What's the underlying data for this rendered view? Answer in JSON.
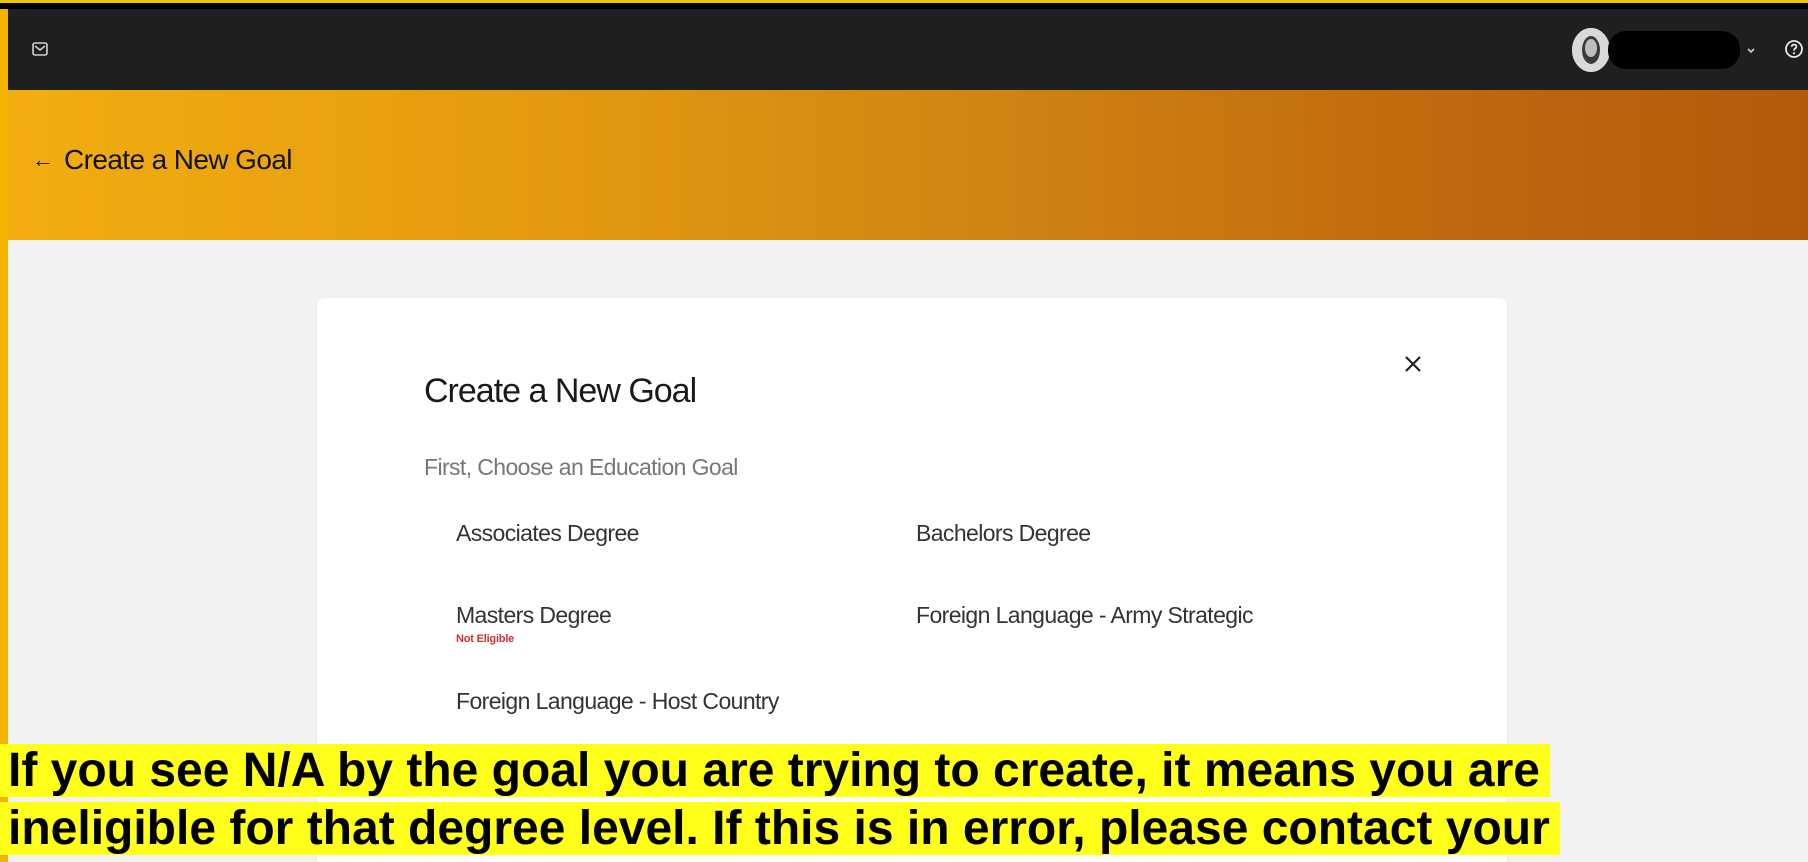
{
  "header": {
    "back_label": "Create a New Goal",
    "back_arrow": "←"
  },
  "icons": {
    "mail": "mail-icon",
    "avatar": "avatar-icon",
    "chevron": "chevron-down-icon",
    "help": "help-icon",
    "close": "close-icon",
    "back": "arrow-left-icon"
  },
  "card": {
    "title": "Create a New Goal",
    "subtitle": "First, Choose an Education Goal",
    "close_glyph": "×",
    "goals": [
      {
        "label": "Associates Degree",
        "note": ""
      },
      {
        "label": "Bachelors Degree",
        "note": ""
      },
      {
        "label": "Masters Degree",
        "note": "Not Eligible"
      },
      {
        "label": "Foreign Language - Army Strategic",
        "note": ""
      },
      {
        "label": "Foreign Language - Host Country",
        "note": ""
      }
    ]
  },
  "annotation": {
    "line1": "If you see N/A by the goal you are trying to create, it means you are",
    "line2": "ineligible for that degree level. If this is in error, please contact your"
  },
  "colors": {
    "frame": "#f5b300",
    "topbar": "#1f1f1f",
    "header_start": "#f2ad10",
    "header_end": "#b35a0a",
    "page_bg": "#f2f2f2",
    "not_eligible": "#d32f2f",
    "highlight": "#ffff1a"
  }
}
